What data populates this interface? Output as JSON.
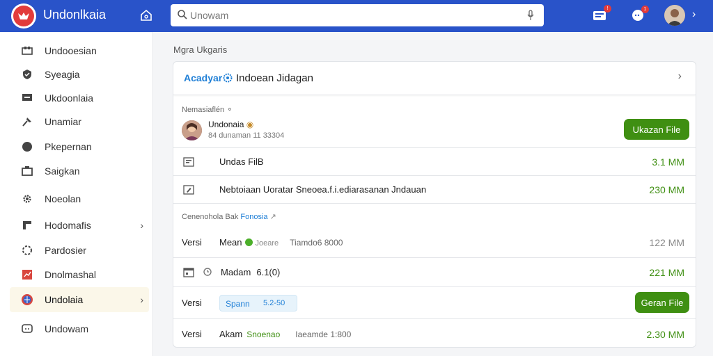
{
  "app": {
    "title": "Undonlkaia"
  },
  "search": {
    "placeholder": "Unowam"
  },
  "notifications": {
    "alerts_badge": "!",
    "chat_badge": "1"
  },
  "sidebar": {
    "items": [
      {
        "label": "Undooesian",
        "icon": "library-icon"
      },
      {
        "label": "Syeagia",
        "icon": "shield-icon"
      },
      {
        "label": "Ukdoonlaia",
        "icon": "monitor-icon"
      },
      {
        "label": "Unamiar",
        "icon": "hammer-icon"
      },
      {
        "label": "Pkepernan",
        "icon": "circle-icon"
      },
      {
        "label": "Saigkan",
        "icon": "camera-icon"
      },
      {
        "label": "Noeolan",
        "icon": "gear-icon"
      },
      {
        "label": "Hodomafis",
        "icon": "flag-icon"
      },
      {
        "label": "Pardosier",
        "icon": "spinner-icon"
      },
      {
        "label": "Dnolmashal",
        "icon": "chart-icon"
      },
      {
        "label": "Undolaia",
        "icon": "globe-icon"
      },
      {
        "label": "Undowam",
        "icon": "chat-icon"
      }
    ]
  },
  "main": {
    "section_title": "Mgra Ukgaris",
    "card": {
      "brand": "Acadyar",
      "title": "Indoean Jidagan",
      "owner_group_label": "Nemasiaflén",
      "owner": {
        "name": "Undonaia",
        "meta": "84 dunaman 11 33304"
      },
      "primary_button": "Ukazan File",
      "files": [
        {
          "label": "Undas FilB",
          "size": "3.1 MM"
        },
        {
          "label": "Nebtoiaan Uoratar Sneoea.f.i.ediarasanan Jndauan",
          "size": "230 MM"
        }
      ],
      "version_group": {
        "label": "Cenenohola Bak",
        "link": "Fonosia"
      },
      "versions": [
        {
          "label": "Versi",
          "name": "Mean",
          "tag": "Joeare",
          "meta": "Tiamdo6 8000",
          "size": "122 MM"
        },
        {
          "name": "Madam",
          "meta": "6.1(0)",
          "size": "221 MM"
        },
        {
          "label": "Versi",
          "pill_a": "Spann",
          "pill_b": "5.2-50",
          "button": "Geran File"
        },
        {
          "label": "Versi",
          "name": "Akam",
          "tag": "Snoenao",
          "meta": "Iaeamde 1:800",
          "size": "2.30 MM"
        }
      ]
    }
  }
}
